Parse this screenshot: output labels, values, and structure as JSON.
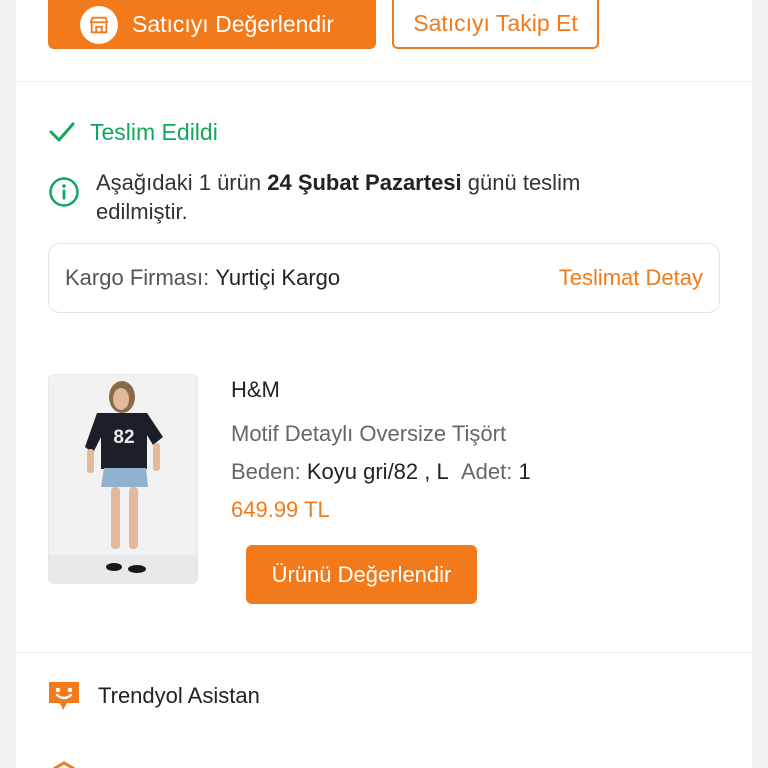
{
  "seller_actions": {
    "rate_label": "Satıcıyı Değerlendir",
    "follow_label": "Satıcıyı Takip Et"
  },
  "delivery": {
    "status": "Teslim Edildi",
    "message_prefix": "Aşağıdaki 1 ürün ",
    "message_date": "24 Şubat Pazartesi",
    "message_suffix": " günü teslim edilmiştir.",
    "cargo_label": "Kargo Firması:",
    "cargo_company": "Yurtiçi Kargo",
    "detail_link": "Teslimat Detay"
  },
  "product": {
    "brand": "H&M",
    "name": "Motif Detaylı Oversize Tişört",
    "size_label": "Beden:",
    "size_value": "Koyu gri/82 , L",
    "qty_label": "Adet:",
    "qty_value": "1",
    "price": "649.99 TL",
    "jersey_number": "82",
    "rate_button": "Ürünü Değerlendir"
  },
  "footer_menu": {
    "assistant_label": "Trendyol Asistan"
  },
  "colors": {
    "accent": "#f27a1a",
    "success": "#10a85d"
  }
}
